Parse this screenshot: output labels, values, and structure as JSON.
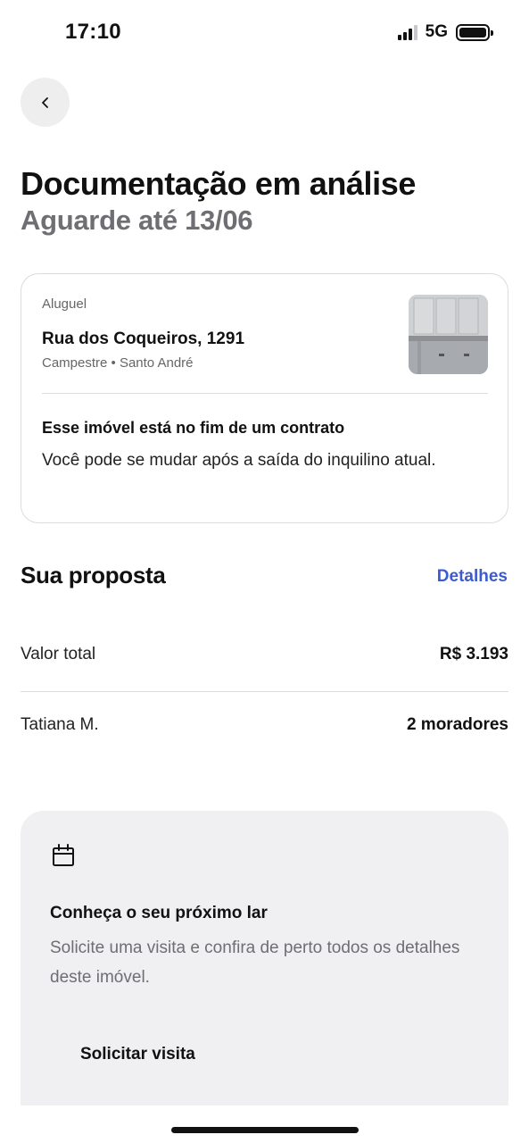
{
  "status_bar": {
    "time": "17:10",
    "network": "5G"
  },
  "header": {
    "title": "Documentação em análise",
    "subtitle": "Aguarde até 13/06"
  },
  "property": {
    "type": "Aluguel",
    "address": "Rua dos Coqueiros, 1291",
    "area": "Campestre • Santo André",
    "notice_title": "Esse imóvel está no fim de um contrato",
    "notice_text": "Você pode se mudar após a saída do inquilino atual."
  },
  "proposal": {
    "title": "Sua proposta",
    "details_label": "Detalhes",
    "rows": [
      {
        "label": "Valor total",
        "value": "R$ 3.193"
      },
      {
        "label": "Tatiana M.",
        "value": "2 moradores"
      }
    ]
  },
  "visit": {
    "icon": "calendar-icon",
    "title": "Conheça o seu próximo lar",
    "text": "Solicite uma visita e confira de perto todos os detalhes deste imóvel.",
    "button_label": "Solicitar visita"
  },
  "colors": {
    "accent": "#3d5bd1",
    "muted_text": "#6e6e73",
    "card_bg": "#f0f0f2"
  }
}
